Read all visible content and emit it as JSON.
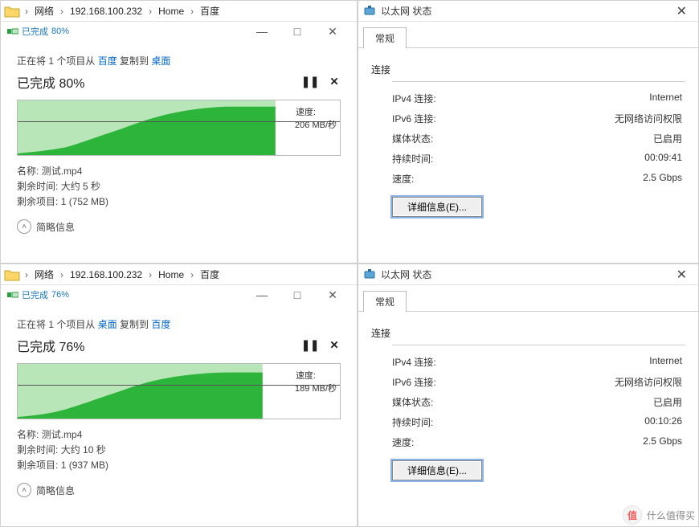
{
  "breadcrumb": {
    "items": [
      "网络",
      "192.168.100.232",
      "Home",
      "百度"
    ],
    "sep": "›"
  },
  "top_copy": {
    "title_prefix": "已完成",
    "percent": "80%",
    "copy_line_prefix": "正在将 1 个项目从",
    "copy_from": "百度",
    "copy_mid": "复制到",
    "copy_to": "桌面",
    "progress_label": "已完成 80%",
    "speed_label": "速度:",
    "speed_value": "206 MB/秒",
    "name_label": "名称:",
    "name_value": "测试.mp4",
    "remain_label": "剩余时间:",
    "remain_value": "大约 5 秒",
    "items_label": "剩余项目:",
    "items_value": "1 (752 MB)",
    "more": "简略信息",
    "fill_pct": 80
  },
  "bottom_copy": {
    "title_prefix": "已完成",
    "percent": "76%",
    "copy_line_prefix": "正在将 1 个项目从",
    "copy_from": "桌面",
    "copy_mid": "复制到",
    "copy_to": "百度",
    "progress_label": "已完成 76%",
    "speed_label": "速度:",
    "speed_value": "189 MB/秒",
    "name_label": "名称:",
    "name_value": "测试.mp4",
    "remain_label": "剩余时间:",
    "remain_value": "大约 10 秒",
    "items_label": "剩余项目:",
    "items_value": "1 (937 MB)",
    "more": "简略信息",
    "fill_pct": 76
  },
  "eth_common": {
    "window_title": "以太网 状态",
    "tab_general": "常规",
    "section_conn": "连接",
    "ipv4_label": "IPv4 连接:",
    "ipv4_value": "Internet",
    "ipv6_label": "IPv6 连接:",
    "ipv6_value": "无网络访问权限",
    "media_label": "媒体状态:",
    "media_value": "已启用",
    "duration_label": "持续时间:",
    "speed_label": "速度:",
    "speed_value": "2.5 Gbps",
    "details_btn": "详细信息(E)..."
  },
  "eth_top": {
    "duration_value": "00:09:41"
  },
  "eth_bottom": {
    "duration_value": "00:10:26"
  },
  "watermark": {
    "text": "什么值得买"
  },
  "chart_data": [
    {
      "type": "area",
      "title": "速度: 206 MB/秒",
      "xlabel": "",
      "ylabel": "MB/秒",
      "x_range": [
        0,
        100
      ],
      "y_range": [
        0,
        260
      ],
      "series": [
        {
          "name": "speed",
          "values": [
            0,
            10,
            15,
            30,
            55,
            90,
            140,
            180,
            200,
            205,
            208,
            206,
            206,
            207,
            206,
            206
          ],
          "current_pct": 80
        }
      ]
    },
    {
      "type": "area",
      "title": "速度: 189 MB/秒",
      "xlabel": "",
      "ylabel": "MB/秒",
      "x_range": [
        0,
        100
      ],
      "y_range": [
        0,
        260
      ],
      "series": [
        {
          "name": "speed",
          "values": [
            0,
            10,
            15,
            28,
            50,
            85,
            135,
            175,
            188,
            190,
            189,
            189,
            190,
            189,
            189,
            189
          ],
          "current_pct": 76
        }
      ]
    }
  ]
}
